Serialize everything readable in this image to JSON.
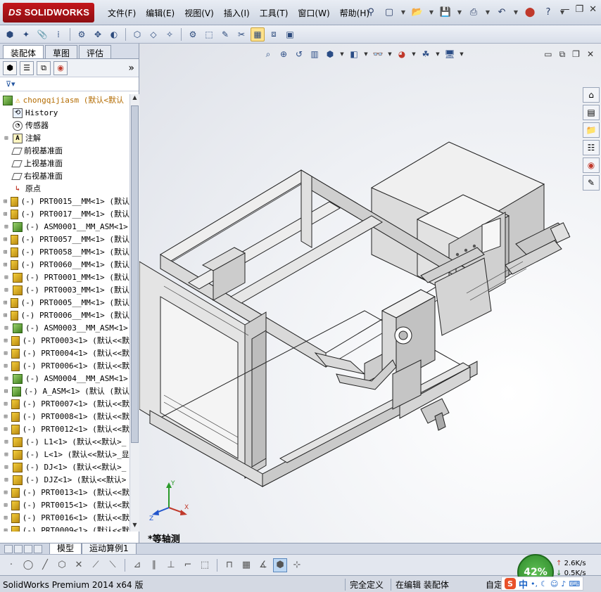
{
  "app": {
    "logo_ds": "DS",
    "logo_text": "SOLIDWORKS",
    "menu": [
      "文件(F)",
      "编辑(E)",
      "视图(V)",
      "插入(I)",
      "工具(T)",
      "窗口(W)",
      "帮助(H)"
    ]
  },
  "panel": {
    "tabs": [
      "装配体",
      "草图",
      "评估"
    ],
    "expand_arrows": "»"
  },
  "tree": {
    "root": "chongqijiasm  (默认<默认",
    "fixed": [
      {
        "label": "History",
        "icon": "history-icon"
      },
      {
        "label": "传感器",
        "icon": "sensor-icon"
      },
      {
        "label": "注解",
        "icon": "annotation-icon"
      },
      {
        "label": "前视基准面",
        "icon": "plane-icon"
      },
      {
        "label": "上视基准面",
        "icon": "plane-icon"
      },
      {
        "label": "右视基准面",
        "icon": "plane-icon"
      },
      {
        "label": "原点",
        "icon": "origin-icon"
      }
    ],
    "components": [
      {
        "label": "(-) PRT0015__MM<1> (默认",
        "type": "part"
      },
      {
        "label": "(-) PRT0017__MM<1> (默认",
        "type": "part"
      },
      {
        "label": "(-) ASM0001__MM_ASM<1>",
        "type": "asm"
      },
      {
        "label": "(-) PRT0057__MM<1> (默认",
        "type": "part"
      },
      {
        "label": "(-) PRT0058__MM<1> (默认",
        "type": "part"
      },
      {
        "label": "(-) PRT0060__MM<1> (默认",
        "type": "part"
      },
      {
        "label": "(-) PRT0001_MM<1> (默认",
        "type": "part"
      },
      {
        "label": "(-) PRT0003_MM<1> (默认",
        "type": "part"
      },
      {
        "label": "(-) PRT0005__MM<1> (默认",
        "type": "part"
      },
      {
        "label": "(-) PRT0006__MM<1> (默认",
        "type": "part"
      },
      {
        "label": "(-) ASM0003__MM_ASM<1>",
        "type": "asm"
      },
      {
        "label": "(-) PRT0003<1> (默认<<默",
        "type": "part"
      },
      {
        "label": "(-) PRT0004<1> (默认<<默",
        "type": "part"
      },
      {
        "label": "(-) PRT0006<1> (默认<<默",
        "type": "part"
      },
      {
        "label": "(-) ASM0004__MM_ASM<1>",
        "type": "asm"
      },
      {
        "label": "(-) A_ASM<1> (默认 (默认",
        "type": "asm"
      },
      {
        "label": "(-) PRT0007<1> (默认<<默",
        "type": "part"
      },
      {
        "label": "(-) PRT0008<1> (默认<<默",
        "type": "part"
      },
      {
        "label": "(-) PRT0012<1> (默认<<默",
        "type": "part"
      },
      {
        "label": "(-) L1<1> (默认<<默认>_",
        "type": "part"
      },
      {
        "label": "(-) L<1> (默认<<默认>_显",
        "type": "part"
      },
      {
        "label": "(-) DJ<1> (默认<<默认>_",
        "type": "part"
      },
      {
        "label": "(-) DJZ<1> (默认<<默认>",
        "type": "part"
      },
      {
        "label": "(-) PRT0013<1> (默认<<默",
        "type": "part"
      },
      {
        "label": "(-) PRT0015<1> (默认<<默",
        "type": "part"
      },
      {
        "label": "(-) PRT0016<1> (默认<<默",
        "type": "part"
      },
      {
        "label": "(-) PRT0009<1> (默认<<默",
        "type": "part"
      }
    ]
  },
  "viewport": {
    "view_label": "*等轴测",
    "triad": {
      "x": "X",
      "y": "Y",
      "z": "Z"
    }
  },
  "bottom_tabs": [
    "模型",
    "运动算例1"
  ],
  "status": {
    "product": "SolidWorks Premium 2014 x64 版",
    "defined": "完全定义",
    "editing": "在编辑 装配体",
    "custom": "自定"
  },
  "net": {
    "cpu": "42%",
    "up": "2.6K/s",
    "down": "0.5K/s"
  },
  "ime": {
    "logo": "S",
    "lang": "中"
  },
  "colors": {
    "accent": "#c4161c",
    "part_icon": "#f4cd3b",
    "asm_icon": "#3f7f1e"
  }
}
